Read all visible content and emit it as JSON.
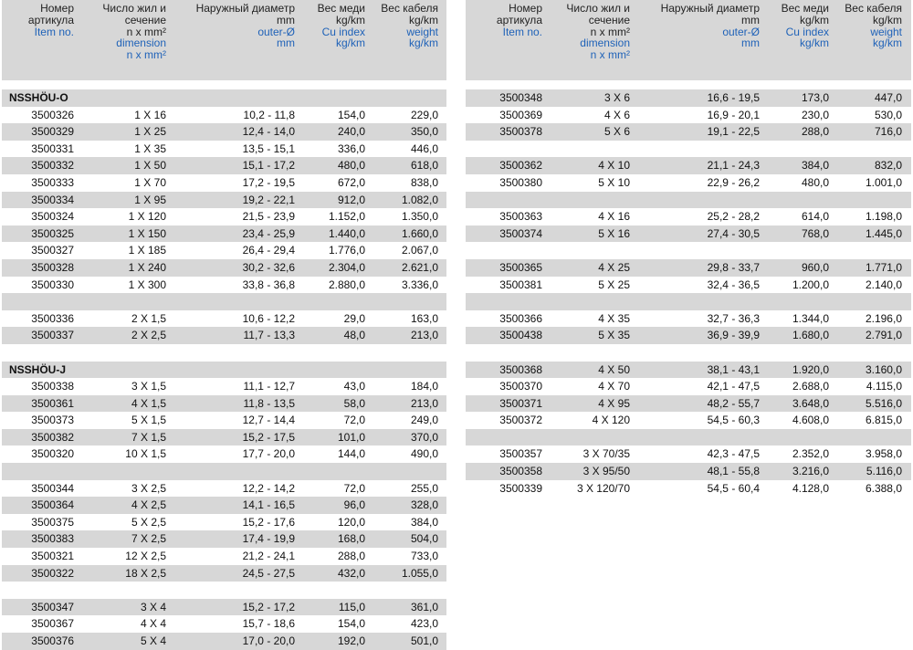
{
  "left": {
    "headers": [
      {
        "ru": [
          "Номер",
          "артикула"
        ],
        "en": [
          "Item no."
        ]
      },
      {
        "ru": [
          "Число жил и",
          "сечение",
          "n x mm²"
        ],
        "en": [
          "dimension",
          "n x mm²"
        ]
      },
      {
        "ru": [
          "Наружный диаметр",
          "mm"
        ],
        "en": [
          "outer-Ø",
          "mm"
        ]
      },
      {
        "ru": [
          "Вес меди",
          "kg/km"
        ],
        "en": [
          "Cu index",
          "kg/km"
        ]
      },
      {
        "ru": [
          "Вес кабеля",
          "kg/km"
        ],
        "en": [
          "weight",
          "kg/km"
        ]
      }
    ],
    "rows": [
      {
        "title": "NSSHÖU-O",
        "bg": true
      },
      {
        "cells": [
          "3500326",
          "1 X 16",
          "10,2 - 11,8",
          "154,0",
          "229,0"
        ]
      },
      {
        "cells": [
          "3500329",
          "1 X 25",
          "12,4 - 14,0",
          "240,0",
          "350,0"
        ],
        "bg": true
      },
      {
        "cells": [
          "3500331",
          "1 X 35",
          "13,5 - 15,1",
          "336,0",
          "446,0"
        ]
      },
      {
        "cells": [
          "3500332",
          "1 X 50",
          "15,1 - 17,2",
          "480,0",
          "618,0"
        ],
        "bg": true
      },
      {
        "cells": [
          "3500333",
          "1 X 70",
          "17,2 - 19,5",
          "672,0",
          "838,0"
        ]
      },
      {
        "cells": [
          "3500334",
          "1 X 95",
          "19,2 - 22,1",
          "912,0",
          "1.082,0"
        ],
        "bg": true
      },
      {
        "cells": [
          "3500324",
          "1 X 120",
          "21,5 - 23,9",
          "1.152,0",
          "1.350,0"
        ]
      },
      {
        "cells": [
          "3500325",
          "1 X 150",
          "23,4 - 25,9",
          "1.440,0",
          "1.660,0"
        ],
        "bg": true
      },
      {
        "cells": [
          "3500327",
          "1 X 185",
          "26,4 - 29,4",
          "1.776,0",
          "2.067,0"
        ]
      },
      {
        "cells": [
          "3500328",
          "1 X 240",
          "30,2 - 32,6",
          "2.304,0",
          "2.621,0"
        ],
        "bg": true
      },
      {
        "cells": [
          "3500330",
          "1 X 300",
          "33,8 - 36,8",
          "2.880,0",
          "3.336,0"
        ]
      },
      {
        "blank": true,
        "bg": true
      },
      {
        "cells": [
          "3500336",
          "2 X 1,5",
          "10,6 - 12,2",
          "29,0",
          "163,0"
        ]
      },
      {
        "cells": [
          "3500337",
          "2 X 2,5",
          "11,7 - 13,3",
          "48,0",
          "213,0"
        ],
        "bg": true
      },
      {
        "blank": true
      },
      {
        "title": "NSSHÖU-J",
        "bg": true
      },
      {
        "cells": [
          "3500338",
          "3 X 1,5",
          "11,1 - 12,7",
          "43,0",
          "184,0"
        ]
      },
      {
        "cells": [
          "3500361",
          "4 X 1,5",
          "11,8 - 13,5",
          "58,0",
          "213,0"
        ],
        "bg": true
      },
      {
        "cells": [
          "3500373",
          "5 X 1,5",
          "12,7 - 14,4",
          "72,0",
          "249,0"
        ]
      },
      {
        "cells": [
          "3500382",
          "7 X 1,5",
          "15,2 - 17,5",
          "101,0",
          "370,0"
        ],
        "bg": true
      },
      {
        "cells": [
          "3500320",
          "10 X 1,5",
          "17,7 - 20,0",
          "144,0",
          "490,0"
        ]
      },
      {
        "blank": true,
        "bg": true
      },
      {
        "cells": [
          "3500344",
          "3 X 2,5",
          "12,2 - 14,2",
          "72,0",
          "255,0"
        ]
      },
      {
        "cells": [
          "3500364",
          "4 X 2,5",
          "14,1 - 16,5",
          "96,0",
          "328,0"
        ],
        "bg": true
      },
      {
        "cells": [
          "3500375",
          "5 X 2,5",
          "15,2 - 17,6",
          "120,0",
          "384,0"
        ]
      },
      {
        "cells": [
          "3500383",
          "7 X 2,5",
          "17,4 - 19,9",
          "168,0",
          "504,0"
        ],
        "bg": true
      },
      {
        "cells": [
          "3500321",
          "12 X 2,5",
          "21,2 - 24,1",
          "288,0",
          "733,0"
        ]
      },
      {
        "cells": [
          "3500322",
          "18 X 2,5",
          "24,5 - 27,5",
          "432,0",
          "1.055,0"
        ],
        "bg": true
      },
      {
        "blank": true
      },
      {
        "cells": [
          "3500347",
          "3 X 4",
          "15,2 - 17,2",
          "115,0",
          "361,0"
        ],
        "bg": true
      },
      {
        "cells": [
          "3500367",
          "4 X 4",
          "15,7 - 18,6",
          "154,0",
          "423,0"
        ]
      },
      {
        "cells": [
          "3500376",
          "5 X 4",
          "17,0 - 20,0",
          "192,0",
          "501,0"
        ],
        "bg": true
      }
    ]
  },
  "right": {
    "headers": [
      {
        "ru": [
          "Номер",
          "артикула"
        ],
        "en": [
          "Item no."
        ]
      },
      {
        "ru": [
          "Число жил и",
          "сечение",
          "n x mm²"
        ],
        "en": [
          "dimension",
          "n x mm²"
        ]
      },
      {
        "ru": [
          "Наружный диаметр",
          "mm"
        ],
        "en": [
          "outer-Ø",
          "mm"
        ]
      },
      {
        "ru": [
          "Вес меди",
          "kg/km"
        ],
        "en": [
          "Cu index",
          "kg/km"
        ]
      },
      {
        "ru": [
          "Вес кабеля",
          "kg/km"
        ],
        "en": [
          "weight",
          "kg/km"
        ]
      }
    ],
    "rows": [
      {
        "cells": [
          "3500348",
          "3 X 6",
          "16,6 - 19,5",
          "173,0",
          "447,0"
        ],
        "bg": true
      },
      {
        "cells": [
          "3500369",
          "4 X 6",
          "16,9 - 20,1",
          "230,0",
          "530,0"
        ]
      },
      {
        "cells": [
          "3500378",
          "5 X 6",
          "19,1 - 22,5",
          "288,0",
          "716,0"
        ],
        "bg": true
      },
      {
        "blank": true
      },
      {
        "cells": [
          "3500362",
          "4 X 10",
          "21,1 - 24,3",
          "384,0",
          "832,0"
        ],
        "bg": true
      },
      {
        "cells": [
          "3500380",
          "5 X 10",
          "22,9 - 26,2",
          "480,0",
          "1.001,0"
        ]
      },
      {
        "blank": true,
        "bg": true
      },
      {
        "cells": [
          "3500363",
          "4 X 16",
          "25,2 - 28,2",
          "614,0",
          "1.198,0"
        ]
      },
      {
        "cells": [
          "3500374",
          "5 X 16",
          "27,4 - 30,5",
          "768,0",
          "1.445,0"
        ],
        "bg": true
      },
      {
        "blank": true
      },
      {
        "cells": [
          "3500365",
          "4 X 25",
          "29,8 - 33,7",
          "960,0",
          "1.771,0"
        ],
        "bg": true
      },
      {
        "cells": [
          "3500381",
          "5 X 25",
          "32,4 - 36,5",
          "1.200,0",
          "2.140,0"
        ]
      },
      {
        "blank": true,
        "bg": true
      },
      {
        "cells": [
          "3500366",
          "4 X 35",
          "32,7 - 36,3",
          "1.344,0",
          "2.196,0"
        ]
      },
      {
        "cells": [
          "3500438",
          "5 X 35",
          "36,9 - 39,9",
          "1.680,0",
          "2.791,0"
        ],
        "bg": true
      },
      {
        "blank": true
      },
      {
        "cells": [
          "3500368",
          "4 X 50",
          "38,1 - 43,1",
          "1.920,0",
          "3.160,0"
        ],
        "bg": true
      },
      {
        "cells": [
          "3500370",
          "4 X 70",
          "42,1 - 47,5",
          "2.688,0",
          "4.115,0"
        ]
      },
      {
        "cells": [
          "3500371",
          "4 X 95",
          "48,2 - 55,7",
          "3.648,0",
          "5.516,0"
        ],
        "bg": true
      },
      {
        "cells": [
          "3500372",
          "4 X 120",
          "54,5 - 60,3",
          "4.608,0",
          "6.815,0"
        ]
      },
      {
        "blank": true,
        "bg": true
      },
      {
        "cells": [
          "3500357",
          "3 X 70/35",
          "42,3 - 47,5",
          "2.352,0",
          "3.958,0"
        ]
      },
      {
        "cells": [
          "3500358",
          "3 X 95/50",
          "48,1 - 55,8",
          "3.216,0",
          "5.116,0"
        ],
        "bg": true
      },
      {
        "cells": [
          "3500339",
          "3 X 120/70",
          "54,5 - 60,4",
          "4.128,0",
          "6.388,0"
        ]
      }
    ]
  }
}
